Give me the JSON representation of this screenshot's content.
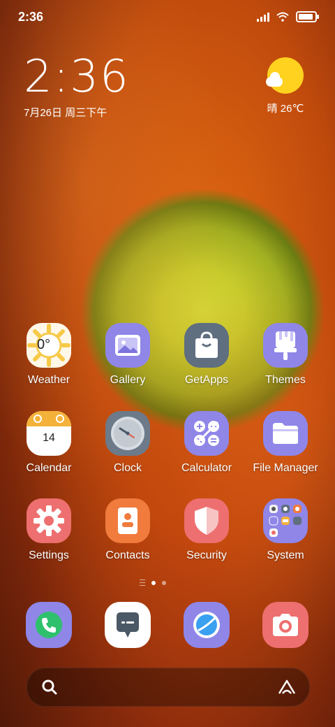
{
  "status_bar": {
    "time": "2:36"
  },
  "clock_widget": {
    "time": "2:36",
    "date": "7月26日 周三下午"
  },
  "weather_widget": {
    "text": "晴 26℃",
    "icon": "partly-sunny-icon"
  },
  "apps": [
    {
      "name": "Weather",
      "icon": "weather-icon",
      "extra": "0°"
    },
    {
      "name": "Gallery",
      "icon": "gallery-icon"
    },
    {
      "name": "GetApps",
      "icon": "getapps-icon"
    },
    {
      "name": "Themes",
      "icon": "themes-icon"
    },
    {
      "name": "Calendar",
      "icon": "calendar-icon",
      "extra": "14"
    },
    {
      "name": "Clock",
      "icon": "clock-icon"
    },
    {
      "name": "Calculator",
      "icon": "calculator-icon"
    },
    {
      "name": "File Manager",
      "icon": "file-manager-icon"
    },
    {
      "name": "Settings",
      "icon": "settings-icon"
    },
    {
      "name": "Contacts",
      "icon": "contacts-icon"
    },
    {
      "name": "Security",
      "icon": "security-icon"
    },
    {
      "name": "System",
      "icon": "system-folder-icon"
    }
  ],
  "page_indicator": {
    "pages": 2,
    "active": 1
  },
  "dock": [
    {
      "icon": "phone-icon"
    },
    {
      "icon": "messages-icon"
    },
    {
      "icon": "browser-icon"
    },
    {
      "icon": "camera-icon"
    }
  ],
  "search_bar": {
    "left_icon": "search-icon",
    "right_icon": "assistant-icon"
  },
  "colors": {
    "purple": "#8f86e8",
    "slate": "#5f6f80",
    "orange": "#f07b3d",
    "red": "#ee6f6f",
    "yellow": "#ffd21f"
  }
}
